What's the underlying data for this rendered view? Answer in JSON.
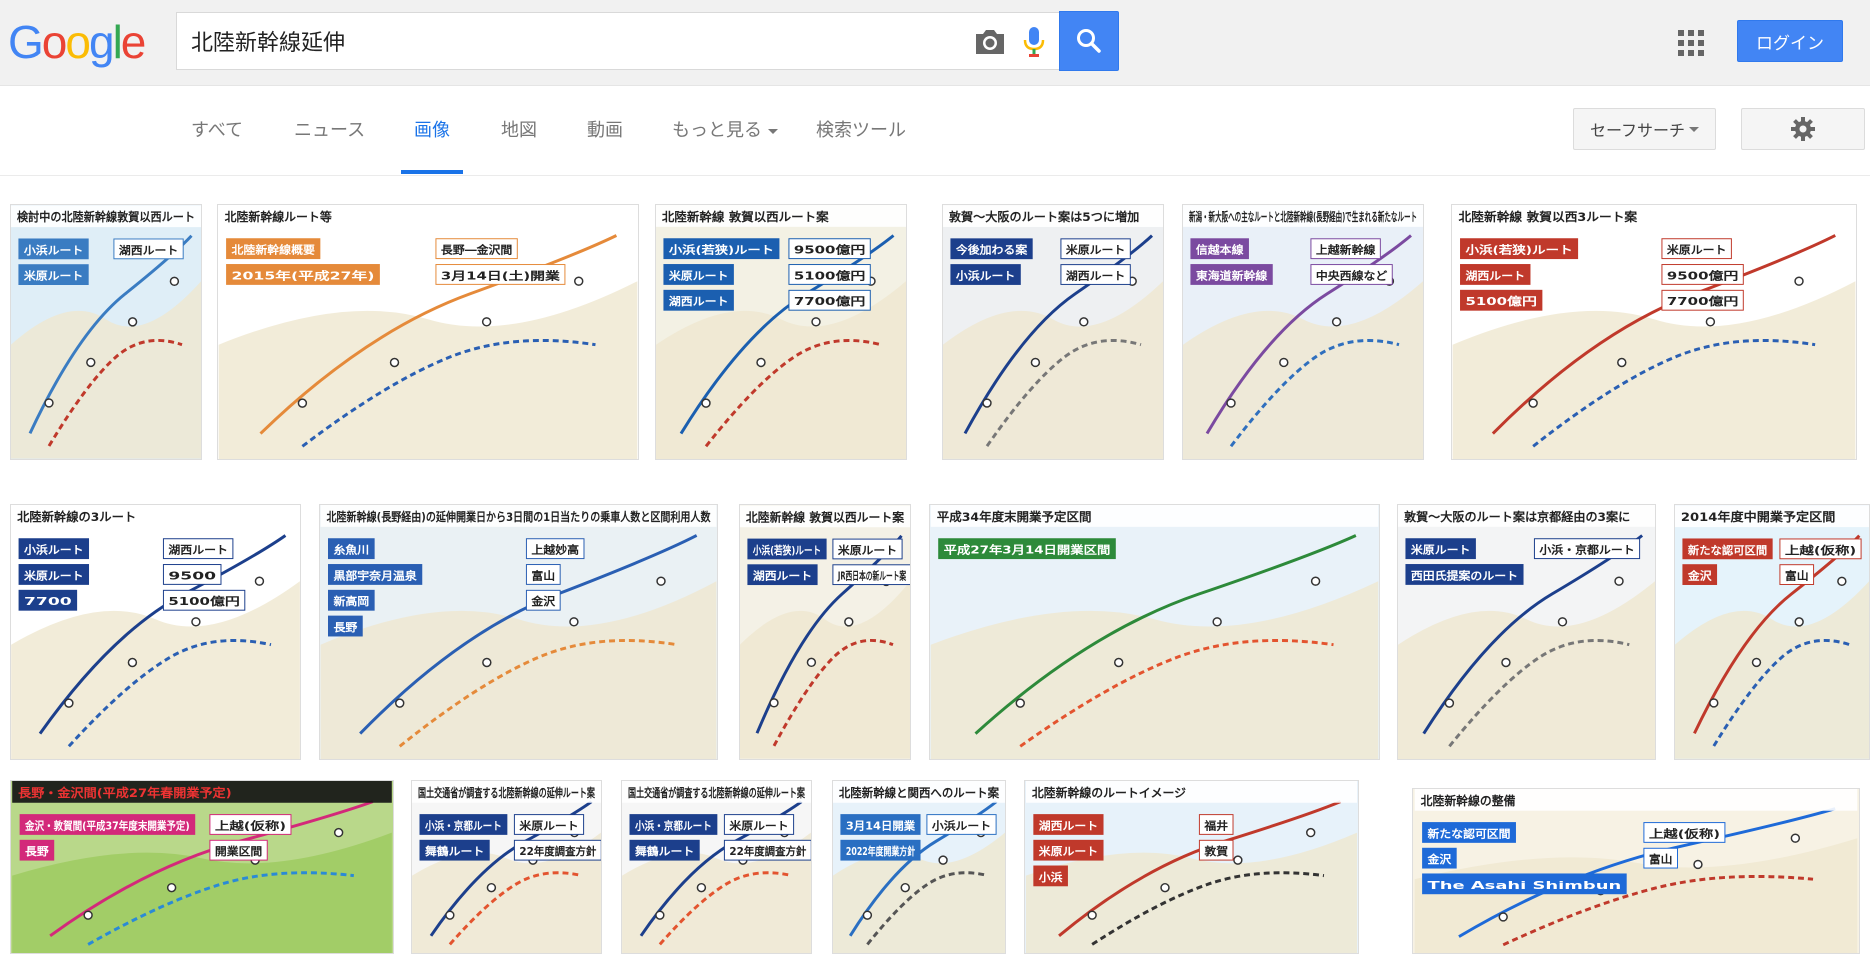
{
  "header": {
    "logo": {
      "letters": [
        "G",
        "o",
        "o",
        "g",
        "l",
        "e"
      ],
      "colors": [
        "#4285f4",
        "#ea4335",
        "#fbbc05",
        "#4285f4",
        "#34a853",
        "#ea4335"
      ]
    },
    "search": {
      "value": "北陸新幹線延伸"
    },
    "login_label": "ログイン"
  },
  "tabs": [
    {
      "label": "すべて"
    },
    {
      "label": "ニュース"
    },
    {
      "label": "画像"
    },
    {
      "label": "地図"
    },
    {
      "label": "動画"
    },
    {
      "label": "もっと見る"
    },
    {
      "label": "検索ツール"
    }
  ],
  "safesearch_label": "セーフサーチ",
  "accent_color": "#4285f4",
  "results": [
    {
      "caption": "検討中の北陸新幹線敦賀以西ルート",
      "labels": [
        "小浜ルート",
        "湖西ルート",
        "米原ルート"
      ]
    },
    {
      "caption": "北陸新幹線ルート等",
      "labels": [
        "北陸新幹線概要",
        "長野―金沢間",
        "2015年(平成27年)",
        "3月14日(土)開業"
      ]
    },
    {
      "caption": "北陸新幹線 敦賀以西ルート案",
      "labels": [
        "小浜(若狭)ルート",
        "9500億円",
        "米原ルート",
        "5100億円",
        "湖西ルート",
        "7700億円"
      ]
    },
    {
      "caption": "敦賀～大阪のルート案は5つに増加",
      "labels": [
        "今後加わる案",
        "米原ルート",
        "小浜ルート",
        "湖西ルート"
      ]
    },
    {
      "caption": "新潟・新大阪への主なルートと北陸新幹線(長野経由)で生まれる新たなルート",
      "labels": [
        "信越本線",
        "上越新幹線",
        "東海道新幹線",
        "中央西線など"
      ]
    },
    {
      "caption": "北陸新幹線 敦賀以西3ルート案",
      "labels": [
        "小浜(若狭)ルート",
        "米原ルート",
        "湖西ルート",
        "9500億円",
        "5100億円",
        "7700億円"
      ]
    },
    {
      "caption": "北陸新幹線の3ルート",
      "labels": [
        "小浜ルート",
        "湖西ルート",
        "米原ルート",
        "9500",
        "7700",
        "5100億円"
      ]
    },
    {
      "caption": "北陸新幹線(長野経由)の延伸開業日から3日間の1日当たりの乗車人数と区間利用人数",
      "labels": [
        "糸魚川",
        "上越妙高",
        "黒部宇奈月温泉",
        "富山",
        "新高岡",
        "金沢",
        "長野"
      ]
    },
    {
      "caption": "北陸新幹線 敦賀以西ルート案",
      "labels": [
        "小浜(若狭)ルート",
        "米原ルート",
        "湖西ルート",
        "JR西日本の新ルート案"
      ]
    },
    {
      "caption": "平成34年度末開業予定区間",
      "labels": [
        "平成27年3月14日開業区間"
      ]
    },
    {
      "caption": "敦賀～大阪のルート案は京都経由の3案に",
      "labels": [
        "米原ルート",
        "小浜・京都ルート",
        "西田氏提案のルート"
      ]
    },
    {
      "caption": "2014年度中開業予定区間",
      "labels": [
        "新たな認可区間",
        "上越(仮称)",
        "金沢",
        "富山"
      ]
    },
    {
      "caption": "長野・金沢間(平成27年春開業予定)",
      "labels": [
        "金沢・敦賀間(平成37年度末開業予定)",
        "上越(仮称)",
        "長野",
        "開業区間"
      ]
    },
    {
      "caption": "国土交通省が調査する北陸新幹線の延伸ルート案",
      "labels": [
        "小浜・京都ルート",
        "米原ルート",
        "舞鶴ルート",
        "22年度調査方針"
      ]
    },
    {
      "caption": "国土交通省が調査する北陸新幹線の延伸ルート案",
      "labels": [
        "小浜・京都ルート",
        "米原ルート",
        "舞鶴ルート",
        "22年度調査方針"
      ]
    },
    {
      "caption": "北陸新幹線と関西へのルート案",
      "labels": [
        "3月14日開業",
        "小浜ルート",
        "2022年度開業方針"
      ]
    },
    {
      "caption": "北陸新幹線のルートイメージ",
      "labels": [
        "湖西ルート",
        "福井",
        "米原ルート",
        "敦賀",
        "小浜"
      ]
    },
    {
      "caption": "北陸新幹線の整備",
      "labels": [
        "新たな認可区間",
        "上越(仮称)",
        "金沢",
        "富山",
        "The Asahi Shimbun"
      ]
    }
  ]
}
